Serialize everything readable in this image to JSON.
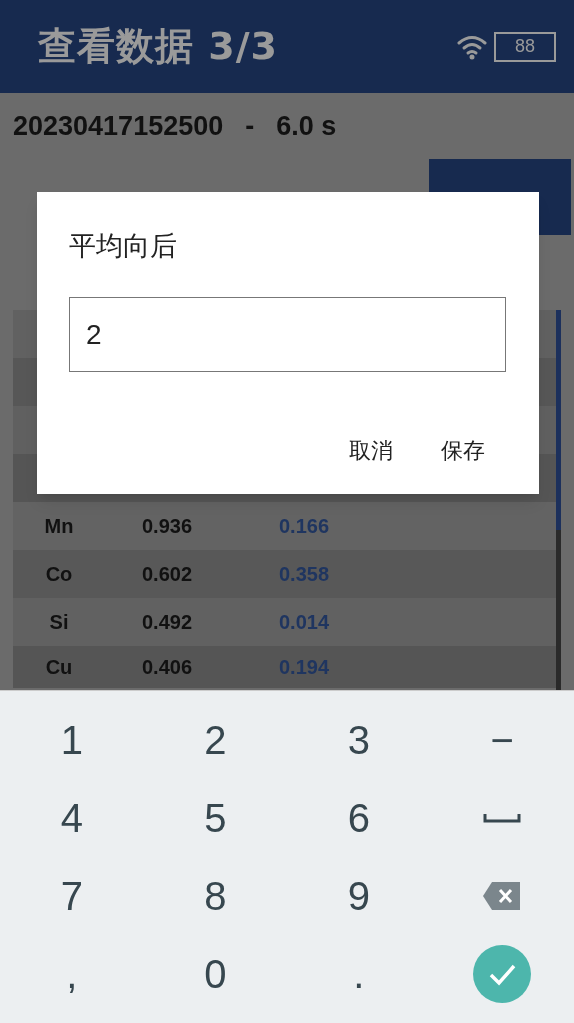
{
  "header": {
    "title": "查看数据 3/3",
    "battery": "88"
  },
  "record": {
    "id": "20230417152500",
    "separator": "-",
    "duration": "6.0 s"
  },
  "table": {
    "rows": [
      {
        "element": "Mn",
        "value_1": "0.936",
        "value_2": "0.166"
      },
      {
        "element": "Co",
        "value_1": "0.602",
        "value_2": "0.358"
      },
      {
        "element": "Si",
        "value_1": "0.492",
        "value_2": "0.014"
      },
      {
        "element": "Cu",
        "value_1": "0.406",
        "value_2": "0.194"
      }
    ]
  },
  "dialog": {
    "title": "平均向后",
    "value": "2",
    "buttons": [
      "取消",
      "保存"
    ]
  },
  "keyboard": {
    "keys": [
      {
        "kind": "char",
        "label": "1"
      },
      {
        "kind": "char",
        "label": "2"
      },
      {
        "kind": "char",
        "label": "3"
      },
      {
        "kind": "char",
        "label": "−"
      },
      {
        "kind": "char",
        "label": "4"
      },
      {
        "kind": "char",
        "label": "5"
      },
      {
        "kind": "char",
        "label": "6"
      },
      {
        "kind": "space"
      },
      {
        "kind": "char",
        "label": "7"
      },
      {
        "kind": "char",
        "label": "8"
      },
      {
        "kind": "char",
        "label": "9"
      },
      {
        "kind": "backspace"
      },
      {
        "kind": "char",
        "label": ","
      },
      {
        "kind": "char",
        "label": "0"
      },
      {
        "kind": "char",
        "label": "."
      },
      {
        "kind": "enter"
      }
    ]
  }
}
